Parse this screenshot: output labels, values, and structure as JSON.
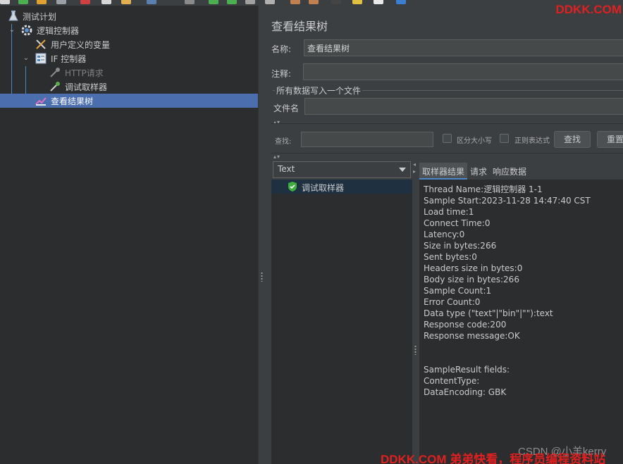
{
  "tree": {
    "items": [
      {
        "label": "测试计划",
        "icon": "test-plan-icon"
      },
      {
        "label": "逻辑控制器",
        "icon": "gear-icon"
      },
      {
        "label": "用户定义的变量",
        "icon": "tools-icon"
      },
      {
        "label": "IF 控制器",
        "icon": "if-controller-icon"
      },
      {
        "label": "HTTP请求",
        "icon": "pipette-icon",
        "disabled": true
      },
      {
        "label": "调试取样器",
        "icon": "pipette-icon"
      },
      {
        "label": "查看结果树",
        "icon": "listener-icon",
        "selected": true
      }
    ]
  },
  "panel": {
    "title": "查看结果树",
    "name_label": "名称:",
    "name_value": "查看结果树",
    "comment_label": "注释:",
    "comment_value": "",
    "file_group_label": "所有数据写入一个文件",
    "filename_label": "文件名",
    "filename_value": ""
  },
  "search": {
    "label": "查找:",
    "value": "",
    "case_label": "区分大小写",
    "regex_label": "正则表达式",
    "find_button": "查找",
    "reset_button": "重置"
  },
  "renderer": {
    "selected": "Text"
  },
  "samples": [
    {
      "label": "调试取样器",
      "status": "success"
    }
  ],
  "tabs": [
    "取样器结果",
    "请求",
    "响应数据"
  ],
  "active_tab": "取样器结果",
  "result_lines": [
    "Thread Name:逻辑控制器 1-1",
    "Sample Start:2023-11-28 14:47:40 CST",
    "Load time:1",
    "Connect Time:0",
    "Latency:0",
    "Size in bytes:266",
    "Sent bytes:0",
    "Headers size in bytes:0",
    "Body size in bytes:266",
    "Sample Count:1",
    "Error Count:0",
    "Data type (\"text\"|\"bin\"|\"\"):text",
    "Response code:200",
    "Response message:OK",
    "",
    "",
    "SampleResult fields:",
    "ContentType:",
    "DataEncoding: GBK"
  ],
  "watermarks": {
    "top": "DDKK.COM",
    "csdn": "CSDN @小羊kerry",
    "bottom": "DDKK.COM 弟弟快看，程序员编程资料站"
  },
  "colors": {
    "selection": "#4b6eaf",
    "background": "#3c3f41",
    "watermark": "#e02020"
  }
}
